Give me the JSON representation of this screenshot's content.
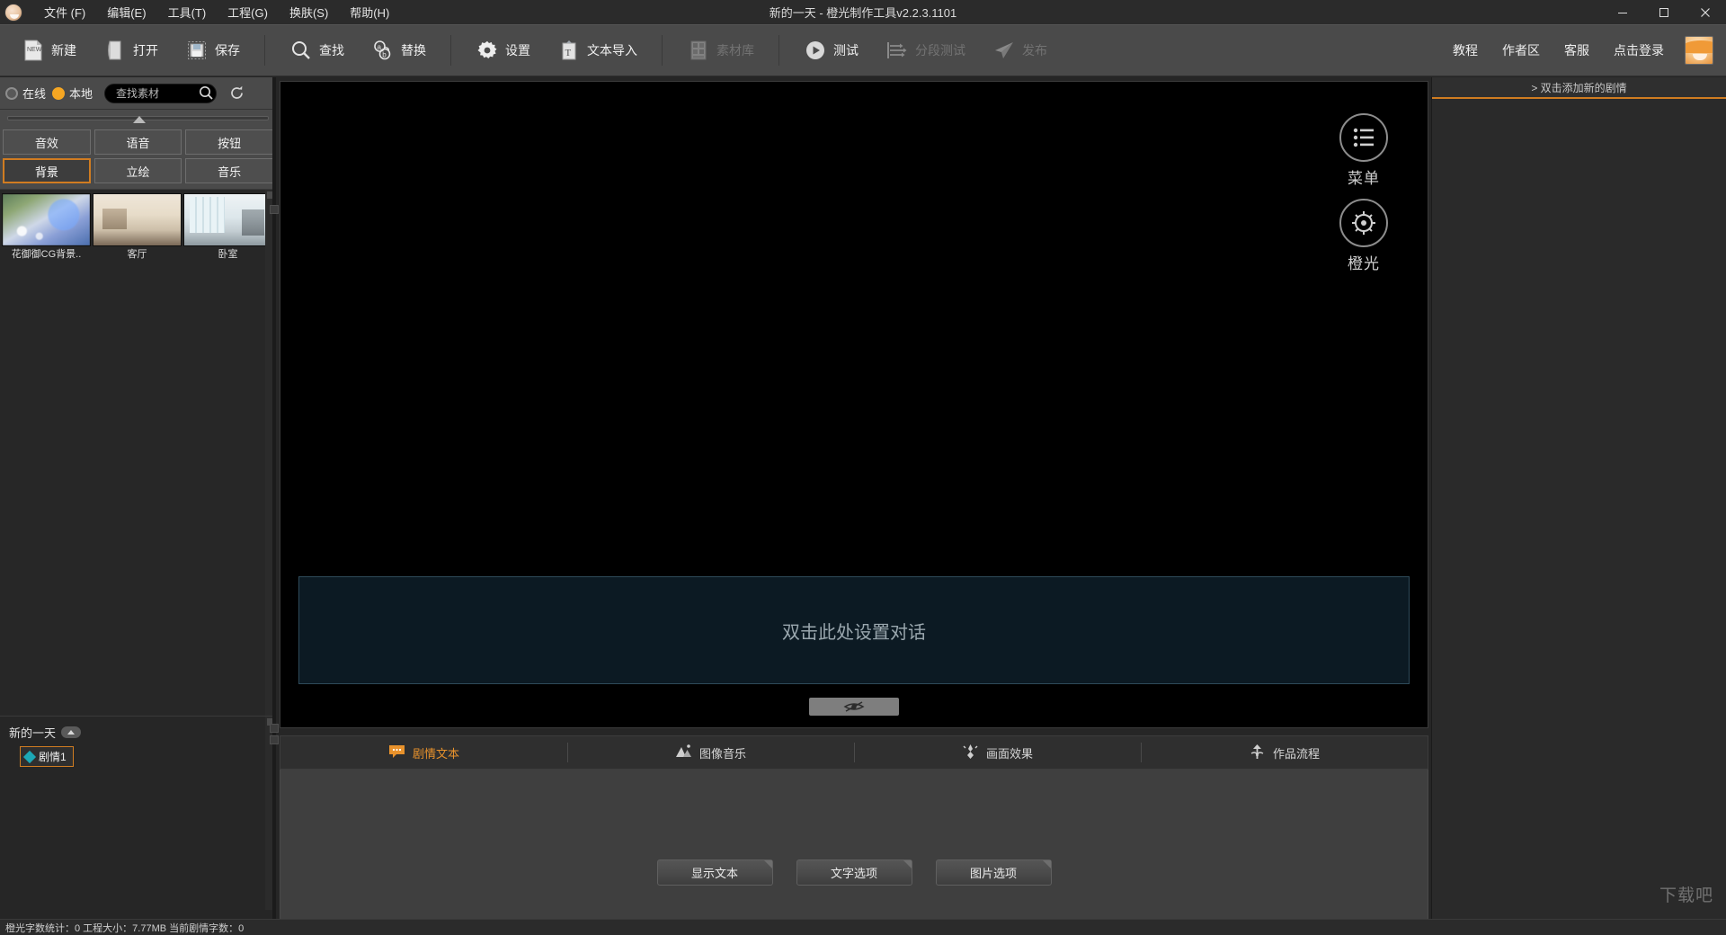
{
  "window": {
    "title": "新的一天 - 橙光制作工具v2.2.3.1101",
    "minimize": "–",
    "maximize": "□",
    "close": "✕"
  },
  "menubar": {
    "items": [
      {
        "label": "文件 (F)"
      },
      {
        "label": "编辑(E)"
      },
      {
        "label": "工具(T)"
      },
      {
        "label": "工程(G)"
      },
      {
        "label": "换肤(S)"
      },
      {
        "label": "帮助(H)"
      }
    ]
  },
  "toolbar": {
    "groups": [
      {
        "buttons": [
          {
            "label": "新建",
            "icon": "new-file-icon",
            "disabled": false
          },
          {
            "label": "打开",
            "icon": "open-folder-icon",
            "disabled": false
          },
          {
            "label": "保存",
            "icon": "save-disk-icon",
            "disabled": false
          }
        ]
      },
      {
        "buttons": [
          {
            "label": "查找",
            "icon": "search-magnifier-icon",
            "disabled": false
          },
          {
            "label": "替换",
            "icon": "replace-icon",
            "disabled": false
          }
        ]
      },
      {
        "buttons": [
          {
            "label": "设置",
            "icon": "gear-icon",
            "disabled": false
          },
          {
            "label": "文本导入",
            "icon": "text-import-icon",
            "disabled": false
          }
        ]
      },
      {
        "buttons": [
          {
            "label": "素材库",
            "icon": "asset-library-icon",
            "disabled": true
          }
        ]
      },
      {
        "buttons": [
          {
            "label": "测试",
            "icon": "play-circle-icon",
            "disabled": false
          },
          {
            "label": "分段测试",
            "icon": "segment-test-icon",
            "disabled": true
          },
          {
            "label": "发布",
            "icon": "paper-plane-icon",
            "disabled": true
          }
        ]
      }
    ],
    "links": [
      {
        "label": "教程"
      },
      {
        "label": "作者区"
      },
      {
        "label": "客服"
      },
      {
        "label": "点击登录"
      }
    ],
    "avatar_name": "user-avatar"
  },
  "asset_panel": {
    "sources": [
      {
        "label": "在线",
        "selected": false
      },
      {
        "label": "本地",
        "selected": true
      }
    ],
    "search": {
      "value": "",
      "placeholder": "查找素材"
    },
    "search_icon": "search-magnifier-icon",
    "refresh_icon": "refresh-icon",
    "categories": [
      {
        "label": "音效",
        "active": false
      },
      {
        "label": "语音",
        "active": false
      },
      {
        "label": "按钮",
        "active": false
      },
      {
        "label": "背景",
        "active": true
      },
      {
        "label": "立绘",
        "active": false
      },
      {
        "label": "音乐",
        "active": false
      }
    ],
    "items": [
      {
        "name": "花御御CG背景..",
        "thumb": "th-flower",
        "selected": false
      },
      {
        "name": "客厅",
        "thumb": "th-living",
        "selected": false
      },
      {
        "name": "卧室",
        "thumb": "th-bed",
        "selected": false
      }
    ]
  },
  "tree": {
    "root_label": "新的一天",
    "collapse_icon": "chevron-up-icon",
    "nodes": [
      {
        "label": "剧情1",
        "selected": true,
        "color": "#1da8b5"
      }
    ]
  },
  "stage": {
    "menu_label": "菜单",
    "menu_icon": "menu-lines-icon",
    "logo_label": "橙光",
    "logo_icon": "orange-light-logo-icon",
    "dialog_placeholder": "双击此处设置对话",
    "eye_button_icon": "eye-toggle-icon"
  },
  "bottom_tabs": [
    {
      "label": "剧情文本",
      "icon": "speech-bubble-icon",
      "active": true
    },
    {
      "label": "图像音乐",
      "icon": "image-music-icon",
      "active": false
    },
    {
      "label": "画面效果",
      "icon": "screen-effect-icon",
      "active": false
    },
    {
      "label": "作品流程",
      "icon": "workflow-icon",
      "active": false
    }
  ],
  "bottom_buttons": [
    {
      "label": "显示文本"
    },
    {
      "label": "文字选项"
    },
    {
      "label": "图片选项"
    }
  ],
  "right_panel": {
    "header": "> 双击添加新的剧情",
    "watermark": "下载吧"
  },
  "statusbar": {
    "text": "橙光字数统计：0  工程大小：7.77MB  当前剧情字数：0"
  },
  "colors": {
    "accent": "#d07c21",
    "tab_active": "#e8922c",
    "toolbar_bg": "#4a4a4a",
    "panel_bg": "#262626",
    "node_marker": "#1da8b5"
  }
}
